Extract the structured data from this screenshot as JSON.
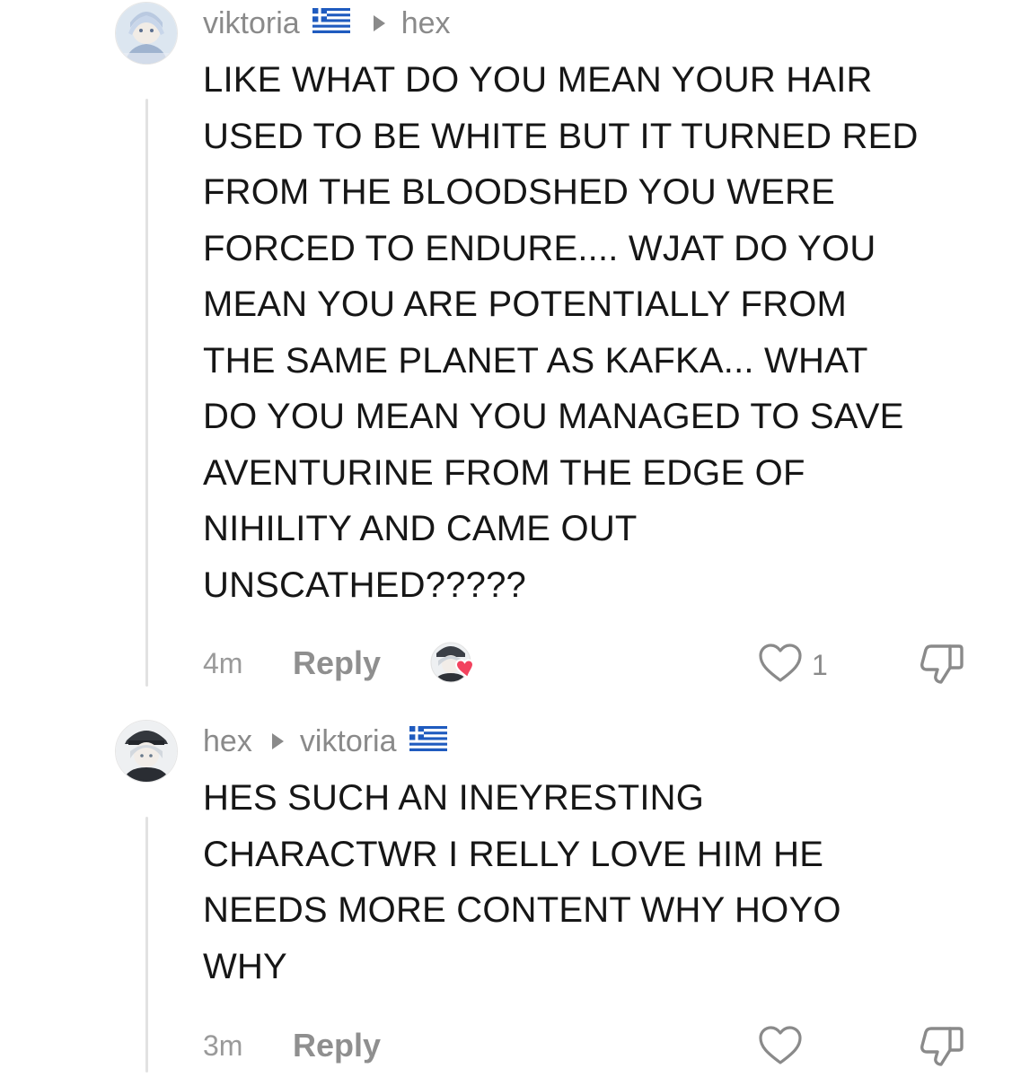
{
  "comments": [
    {
      "author": "viktoria",
      "author_flag": "greece-flag",
      "reply_to": "hex",
      "lines": [
        "LIKE WHAT DO YOU MEAN YOUR HAIR",
        "USED TO BE WHITE BUT IT TURNED RED",
        "FROM THE BLOODSHED YOU WERE",
        "FORCED TO ENDURE.... WJAT DO YOU",
        "MEAN YOU ARE POTENTIALLY FROM",
        "THE SAME PLANET AS KAFKA... WHAT",
        "DO YOU MEAN YOU MANAGED TO SAVE",
        "AVENTURINE FROM THE EDGE OF",
        "NIHILITY AND CAME OUT",
        "UNSCATHED?????"
      ],
      "time": "4m",
      "reply_label": "Reply",
      "like_count": "1",
      "liked_by_creator": true,
      "icons": [
        "heart-outline-icon",
        "dislike-icon"
      ]
    },
    {
      "author": "hex",
      "reply_to": "viktoria",
      "reply_to_flag": "greece-flag",
      "lines": [
        "HES SUCH AN INEYRESTING",
        "CHARACTWR I RELLY LOVE HIM HE",
        "NEEDS MORE CONTENT WHY HOYO",
        "WHY"
      ],
      "time": "3m",
      "reply_label": "Reply",
      "icons": [
        "heart-outline-icon",
        "dislike-icon"
      ]
    }
  ],
  "colors": {
    "text": "#161616",
    "muted": "#8a8a8a",
    "thread_line": "#e2e2e2",
    "heart_badge": "#f2425e",
    "flag_blue": "#1f5bbf"
  }
}
